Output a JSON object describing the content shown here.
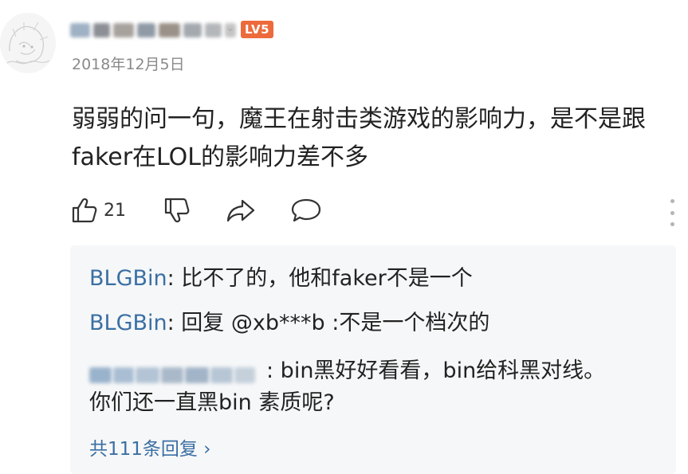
{
  "comment": {
    "date": "2018年12月5日",
    "level_badge": "LV5",
    "text": "弱弱的问一句，魔王在射击类游戏的影响力，是不是跟faker在LOL的影响力差不多",
    "likes": "21"
  },
  "replies": [
    {
      "author": "BLGBin",
      "text": ": 比不了的，他和faker不是一个"
    },
    {
      "author": "BLGBin",
      "text": ": 回复 @xb***b :不是一个档次的"
    },
    {
      "author": "",
      "text": ": bin黑好好看看，bin给科黑对线。",
      "text2": "你们还一直黑bin 素质呢?"
    }
  ],
  "view_all_replies": "共111条回复 ›",
  "icons": [
    "avatar",
    "chevron-down-icon",
    "thumbs-up-icon",
    "thumbs-down-icon",
    "share-icon",
    "comment-icon",
    "more-vertical-icon"
  ],
  "colors": {
    "link": "#3a6fa4",
    "badge": "#ec6a3b",
    "reply_bg": "#f6f7f8",
    "date": "#8a8a8a"
  }
}
